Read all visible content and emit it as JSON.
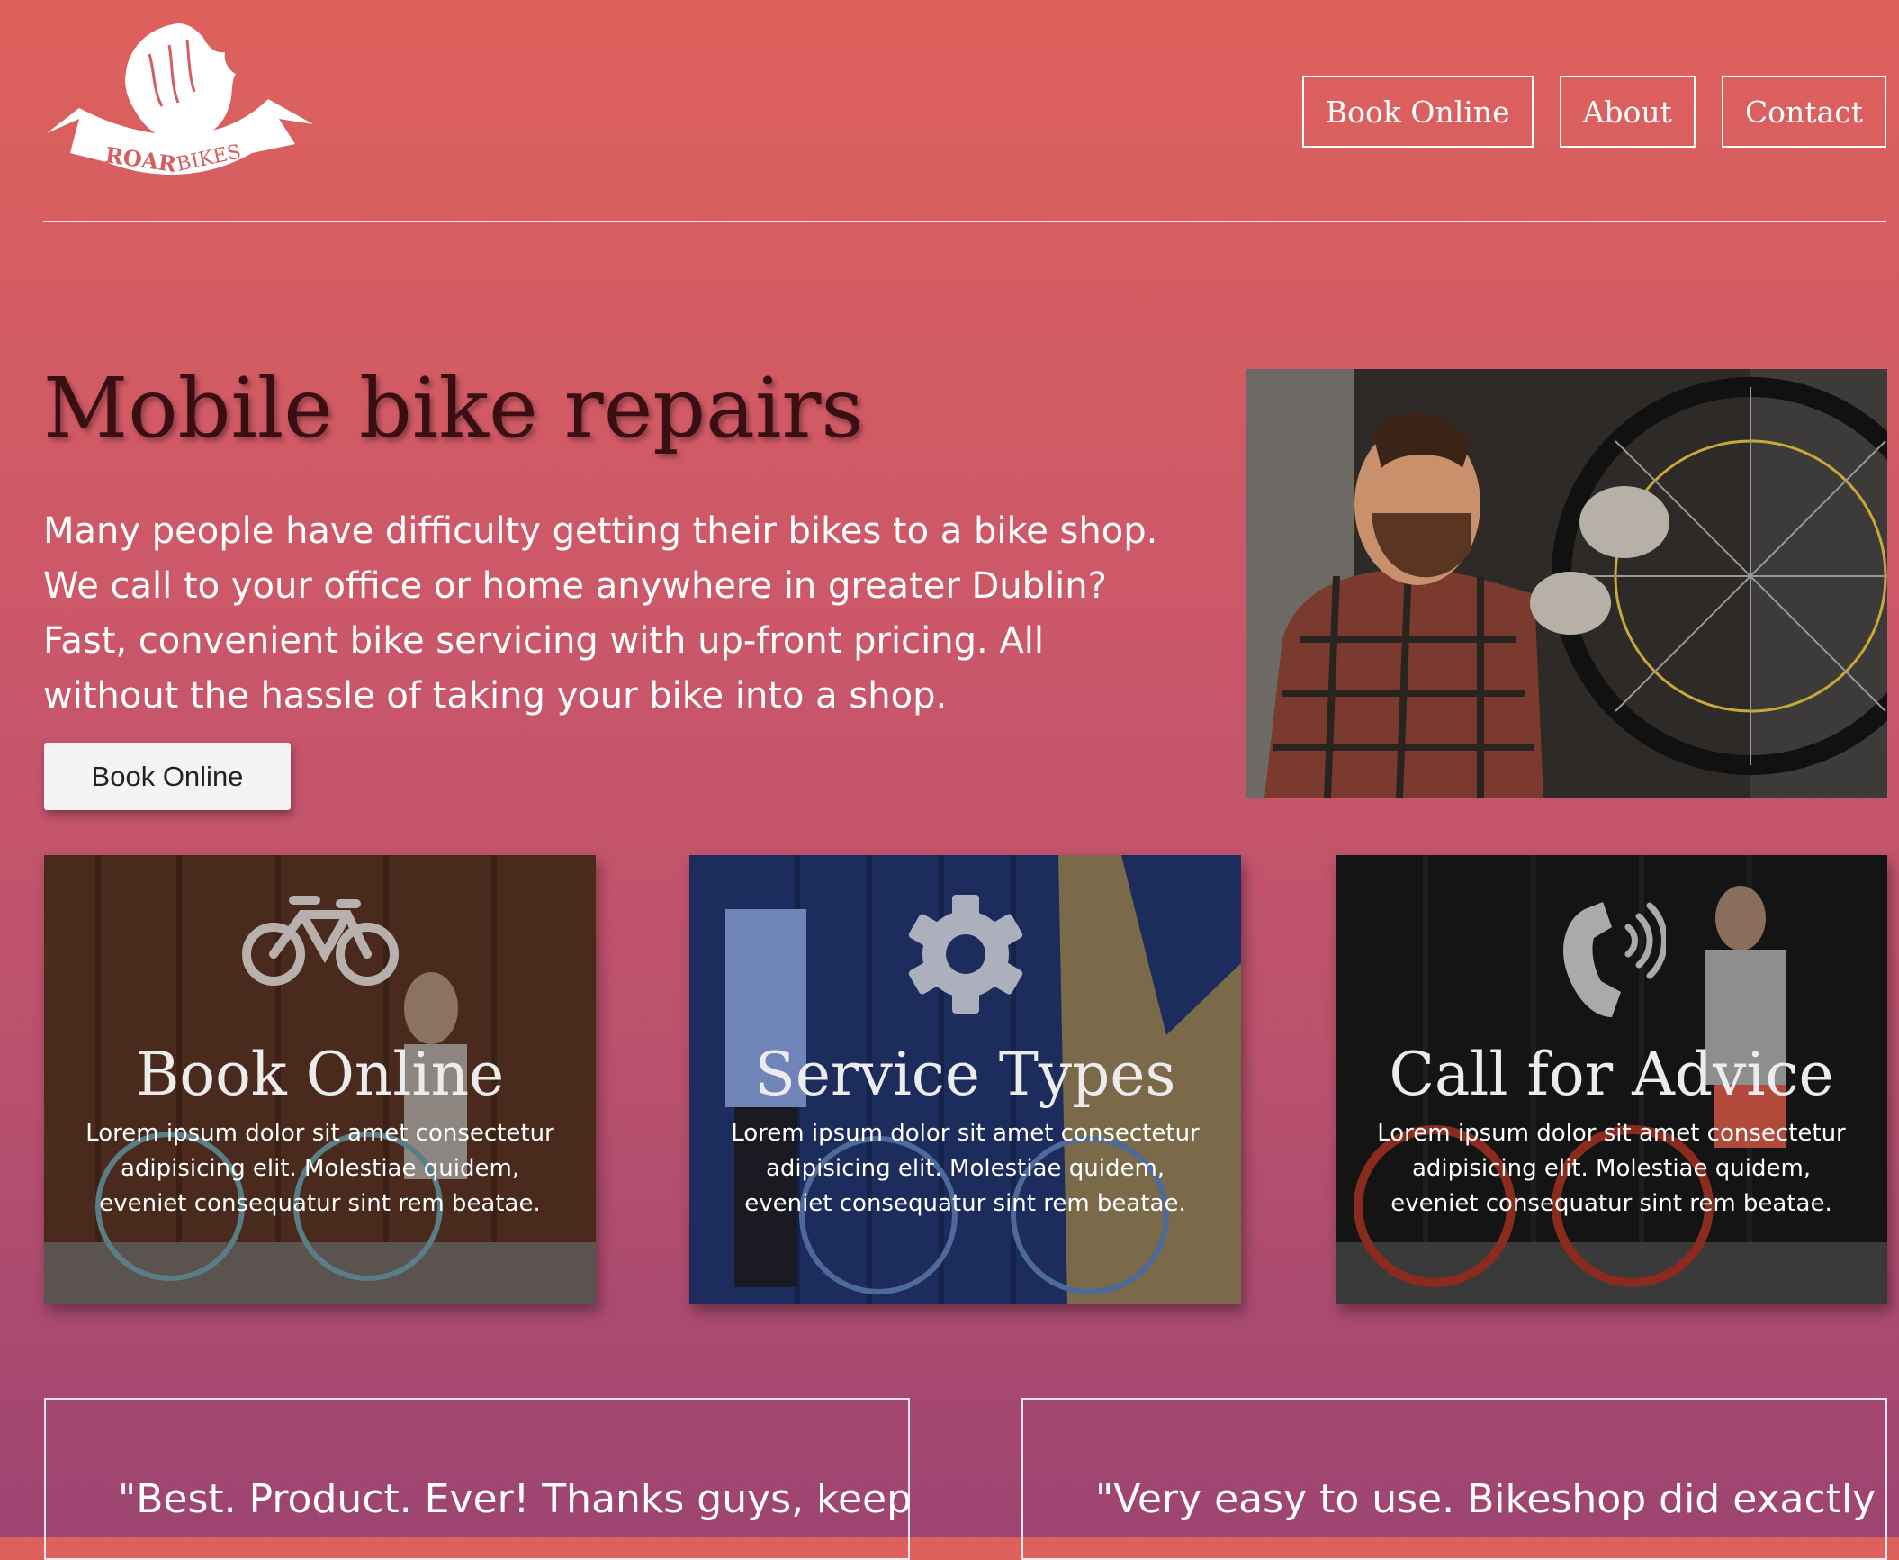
{
  "brand": {
    "logo_text_1": "ROAR",
    "logo_text_2": "BIKES"
  },
  "nav": {
    "items": [
      "Book Online",
      "About",
      "Contact"
    ]
  },
  "hero": {
    "title": "Mobile bike repairs",
    "text": "Many people have difficulty getting their bikes to a bike shop. We call to your office or home anywhere in greater Dublin? Fast, convenient bike servicing with up-front pricing. All without the hassle of taking your bike into a shop.",
    "button": "Book Online"
  },
  "cards": [
    {
      "title": "Book Online",
      "icon": "bicycle-icon",
      "text": "Lorem ipsum dolor sit amet consectetur adipisicing elit. Molestiae quidem, eveniet consequatur sint rem beatae."
    },
    {
      "title": "Service Types",
      "icon": "gear-icon",
      "text": "Lorem ipsum dolor sit amet consectetur adipisicing elit. Molestiae quidem, eveniet consequatur sint rem beatae."
    },
    {
      "title": "Call for Advice",
      "icon": "phone-icon",
      "text": "Lorem ipsum dolor sit amet consectetur adipisicing elit. Molestiae quidem, eveniet consequatur sint rem beatae."
    }
  ],
  "testimonials": [
    {
      "text": "\"Best. Product. Ever! Thanks guys, keep"
    },
    {
      "text": "\"Very easy to use. Bikeshop did exactly"
    }
  ],
  "colors": {
    "accent": "#de615c",
    "title": "#3a0f14"
  }
}
